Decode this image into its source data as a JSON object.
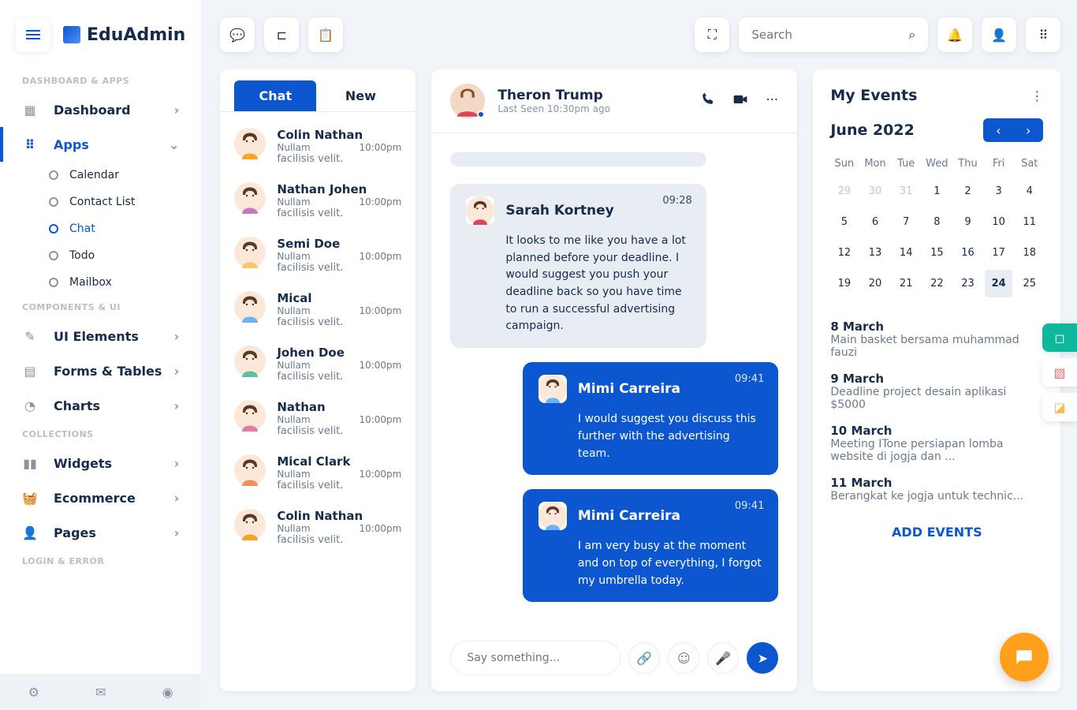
{
  "brand": "EduAdmin",
  "search": {
    "placeholder": "Search"
  },
  "nav": {
    "sec1": "DASHBOARD & APPS",
    "dashboard": "Dashboard",
    "apps": "Apps",
    "sub": {
      "calendar": "Calendar",
      "contact": "Contact List",
      "chat": "Chat",
      "todo": "Todo",
      "mailbox": "Mailbox"
    },
    "sec2": "COMPONENTS & UI",
    "ui": "UI Elements",
    "forms": "Forms & Tables",
    "charts": "Charts",
    "sec3": "COLLECTIONS",
    "widgets": "Widgets",
    "ecom": "Ecommerce",
    "pages": "Pages",
    "sec4": "LOGIN & ERROR"
  },
  "tabs": {
    "chat": "Chat",
    "new": "New"
  },
  "contacts": [
    {
      "name": "Colin Nathan",
      "time": "10:00pm",
      "l1": "Nullam",
      "l2": "facilisis velit.",
      "color": "#f5a623"
    },
    {
      "name": "Nathan Johen",
      "time": "10:00pm",
      "l1": "Nullam",
      "l2": "facilisis velit.",
      "color": "#c17bb8"
    },
    {
      "name": "Semi Doe",
      "time": "10:00pm",
      "l1": "Nullam",
      "l2": "facilisis velit.",
      "color": "#f5c86b"
    },
    {
      "name": "Mical",
      "time": "10:00pm",
      "l1": "Nullam",
      "l2": "facilisis velit.",
      "color": "#6bb3f5"
    },
    {
      "name": "Johen Doe",
      "time": "10:00pm",
      "l1": "Nullam",
      "l2": "facilisis velit.",
      "color": "#5bc0a0"
    },
    {
      "name": "Nathan",
      "time": "10:00pm",
      "l1": "Nullam",
      "l2": "facilisis velit.",
      "color": "#e07ba8"
    },
    {
      "name": "Mical Clark",
      "time": "10:00pm",
      "l1": "Nullam",
      "l2": "facilisis velit.",
      "color": "#f08f5b"
    },
    {
      "name": "Colin Nathan",
      "time": "10:00pm",
      "l1": "Nullam",
      "l2": "facilisis velit.",
      "color": "#f5a623"
    }
  ],
  "chat": {
    "name": "Theron Trump",
    "status": "Last Seen 10:30pm ago",
    "messages": [
      {
        "dir": "in",
        "name": "Sarah Kortney",
        "time": "09:28",
        "text": "It looks to me like you have a lot planned before your deadline. I would suggest you push your deadline back so you have time to run a successful advertising campaign."
      },
      {
        "dir": "out",
        "name": "Mimi Carreira",
        "time": "09:41",
        "text": "I would suggest you discuss this further with the advertising team."
      },
      {
        "dir": "out",
        "name": "Mimi Carreira",
        "time": "09:41",
        "text": "I am very busy at the moment and on top of everything, I forgot my umbrella today."
      }
    ],
    "placeholder": "Say something..."
  },
  "events": {
    "title": "My Events",
    "month": "June 2022",
    "dow": [
      "Sun",
      "Mon",
      "Tue",
      "Wed",
      "Thu",
      "Fri",
      "Sat"
    ],
    "prev": [
      "29",
      "30",
      "31"
    ],
    "days": [
      "1",
      "2",
      "3",
      "4",
      "5",
      "6",
      "7",
      "8",
      "9",
      "10",
      "11",
      "12",
      "13",
      "14",
      "15",
      "16",
      "17",
      "18",
      "19",
      "20",
      "21",
      "22",
      "23",
      "24",
      "25"
    ],
    "today": "24",
    "list": [
      {
        "d": "8 March",
        "t": "Main basket bersama muhammad fauzi"
      },
      {
        "d": "9 March",
        "t": "Deadline project desain aplikasi $5000"
      },
      {
        "d": "10 March",
        "t": "Meeting ITone persiapan lomba website di jogja dan ..."
      },
      {
        "d": "11 March",
        "t": "Berangkat ke jogja untuk technic..."
      }
    ],
    "add": "ADD EVENTS"
  }
}
